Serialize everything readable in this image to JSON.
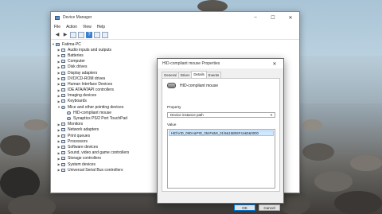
{
  "device_manager": {
    "title": "Device Manager",
    "menu": [
      "File",
      "Action",
      "View",
      "Help"
    ],
    "tree": {
      "root": "Fatima-PC",
      "items": [
        {
          "label": "Audio inputs and outputs",
          "expanded": false
        },
        {
          "label": "Batteries",
          "expanded": false
        },
        {
          "label": "Computer",
          "expanded": false
        },
        {
          "label": "Disk drives",
          "expanded": false
        },
        {
          "label": "Display adapters",
          "expanded": false
        },
        {
          "label": "DVD/CD-ROM drives",
          "expanded": false
        },
        {
          "label": "Human Interface Devices",
          "expanded": false
        },
        {
          "label": "IDE ATA/ATAPI controllers",
          "expanded": false
        },
        {
          "label": "Imaging devices",
          "expanded": false
        },
        {
          "label": "Keyboards",
          "expanded": false
        },
        {
          "label": "Mice and other pointing devices",
          "expanded": true,
          "children": [
            "HID-compliant mouse",
            "Synaptics PS/2 Port TouchPad"
          ]
        },
        {
          "label": "Monitors",
          "expanded": false
        },
        {
          "label": "Network adapters",
          "expanded": false
        },
        {
          "label": "Print queues",
          "expanded": false
        },
        {
          "label": "Processors",
          "expanded": false
        },
        {
          "label": "Software devices",
          "expanded": false
        },
        {
          "label": "Sound, video and game controllers",
          "expanded": false
        },
        {
          "label": "Storage controllers",
          "expanded": false
        },
        {
          "label": "System devices",
          "expanded": false
        },
        {
          "label": "Universal Serial Bus controllers",
          "expanded": false
        }
      ]
    }
  },
  "properties_dialog": {
    "title": "HID-compliant mouse Properties",
    "tabs": [
      "General",
      "Driver",
      "Details",
      "Events"
    ],
    "active_tab": "Details",
    "device_name": "HID-compliant mouse",
    "property_label": "Property",
    "property_value": "Device instance path",
    "value_label": "Value",
    "value": "HID\\VID_09DA&PID_054F&MI_01\\8&15B55F44&0&0000",
    "ok_label": "OK",
    "cancel_label": "Cancel"
  },
  "window_controls": {
    "minimize": "–",
    "maximize": "☐",
    "close": "✕"
  },
  "colors": {
    "selection": "#cde8ff",
    "accent": "#0078d7"
  }
}
